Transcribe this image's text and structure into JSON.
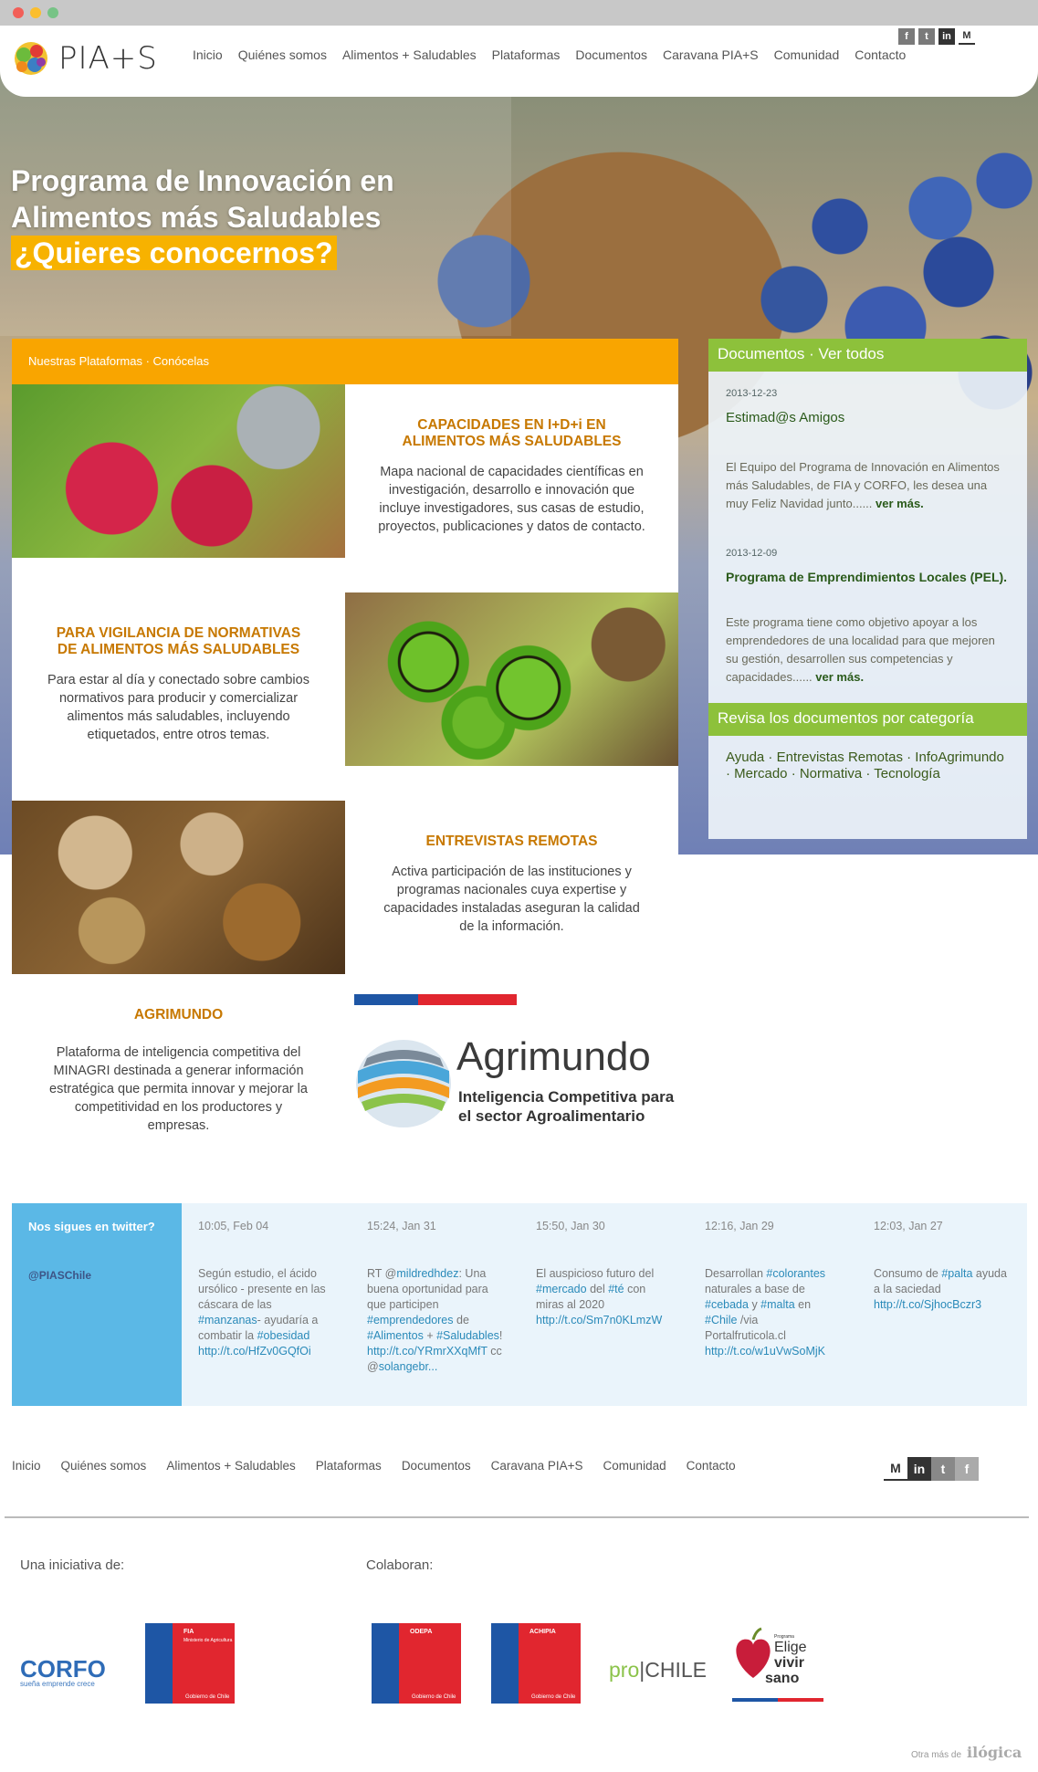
{
  "brand": {
    "name": "PIA+S"
  },
  "nav": [
    "Inicio",
    "Quiénes somos",
    "Alimentos + Saludables",
    "Plataformas",
    "Documentos",
    "Caravana PIA+S",
    "Comunidad",
    "Contacto"
  ],
  "social": [
    "f",
    "t",
    "in",
    "M"
  ],
  "hero": {
    "line1": "Programa de Innovación en",
    "line2": "Alimentos más Saludables",
    "highlight": "¿Quieres conocernos?"
  },
  "platforms": {
    "header": "Nuestras Plataformas · Conócelas",
    "items": [
      {
        "title": "CAPACIDADES EN I+D+i EN ALIMENTOS MÁS SALUDABLES",
        "body": "Mapa nacional de capacidades científicas en investigación, desarrollo e innovación que incluye investigadores, sus casas de estudio, proyectos, publicaciones y datos de contacto."
      },
      {
        "title": "PARA VIGILANCIA DE NORMATIVAS DE ALIMENTOS MÁS SALUDABLES",
        "body": "Para estar al día y conectado sobre cambios normativos para producir y comercializar alimentos más saludables, incluyendo etiquetados, entre otros temas."
      },
      {
        "title": "ENTREVISTAS REMOTAS",
        "body": "Activa participación de las instituciones y programas nacionales cuya expertise y capacidades instaladas aseguran la calidad de la información."
      },
      {
        "title": "AGRIMUNDO",
        "body": "Plataforma de inteligencia competitiva del MINAGRI destinada a generar información estratégica que permita innovar y mejorar la competitividad en los productores y empresas."
      }
    ],
    "agrimundo_logo": {
      "name": "Agrimundo",
      "sub1": "Inteligencia Competitiva para",
      "sub2": "el sector Agroalimentario"
    }
  },
  "documents": {
    "header": "Documentos · Ver todos",
    "items": [
      {
        "date": "2013-12-23",
        "title": "Estimad@s Amigos",
        "body": "El Equipo del Programa de Innovación en Alimentos más Saludables, de FIA y CORFO, les desea una muy Feliz Navidad junto......",
        "more": "ver más."
      },
      {
        "date": "2013-12-09",
        "title": "Programa de Emprendimientos Locales (PEL).",
        "body": "Este programa tiene como objetivo apoyar a los emprendedores de una localidad para que mejoren su gestión, desarrollen sus competencias y capacidades......",
        "more": "ver más."
      }
    ],
    "cat_header": "Revisa los documentos por categoría",
    "categories": "Ayuda · Entrevistas Remotas · InfoAgrimundo · Mercado · Normativa · Tecnología"
  },
  "twitter": {
    "prompt": "Nos sigues en twitter?",
    "handle": "@PIASChile",
    "tweets": [
      {
        "time": "10:05, Feb 04",
        "html": "Según estudio, el ácido ursólico - presente en las cáscara de las <span class='lnk'>#manzanas</span>- ayudaría a combatir la <span class='lnk'>#obesidad</span> <span class='lnk'>http://t.co/HfZv0GQfOi</span>"
      },
      {
        "time": "15:24, Jan 31",
        "html": "RT @<span class='lnk'>mildredhdez</span>: Una buena oportunidad para que participen <span class='lnk'>#emprendedores</span> de <span class='lnk'>#Alimentos</span> + <span class='lnk'>#Saludables</span>! <span class='lnk'>http://t.co/YRmrXXqMfT</span> cc @<span class='lnk'>solangebr...</span>"
      },
      {
        "time": "15:50, Jan 30",
        "html": "El auspicioso futuro del <span class='lnk'>#mercado</span> del <span class='lnk'>#té</span> con miras al 2020 <span class='lnk'>http://t.co/Sm7n0KLmzW</span>"
      },
      {
        "time": "12:16, Jan 29",
        "html": "Desarrollan <span class='lnk'>#colorantes</span> naturales a base de <span class='lnk'>#cebada</span> y <span class='lnk'>#malta</span> en <span class='lnk'>#Chile</span> /via Portalfruticola.cl <span class='lnk'>http://t.co/w1uVwSoMjK</span>"
      },
      {
        "time": "12:03, Jan 27",
        "html": "Consumo de <span class='lnk'>#palta</span> ayuda a la saciedad <span class='lnk'>http://t.co/SjhocBczr3</span>"
      }
    ]
  },
  "footer": {
    "nav": [
      "Inicio",
      "Quiénes somos",
      "Alimentos + Saludables",
      "Plataformas",
      "Documentos",
      "Caravana PIA+S",
      "Comunidad",
      "Contacto"
    ],
    "initiative": "Una iniciativa de:",
    "collab": "Colaboran:",
    "logos": {
      "corfo": "CORFO",
      "corfo_sub": "sueña emprende crece",
      "fia": "FIA",
      "fia_sub": "Ministerio de Agricultura",
      "odepa": "ODEPA",
      "achipia": "ACHIPIA",
      "gob": "Gobierno de Chile",
      "prochile_a": "pro",
      "prochile_b": "|CHILE",
      "elige_small": "Programa",
      "elige": "Elige",
      "vivir": "vivir",
      "sano": "sano"
    },
    "credit": "Otra más de",
    "credit_brand": "ilógica"
  }
}
